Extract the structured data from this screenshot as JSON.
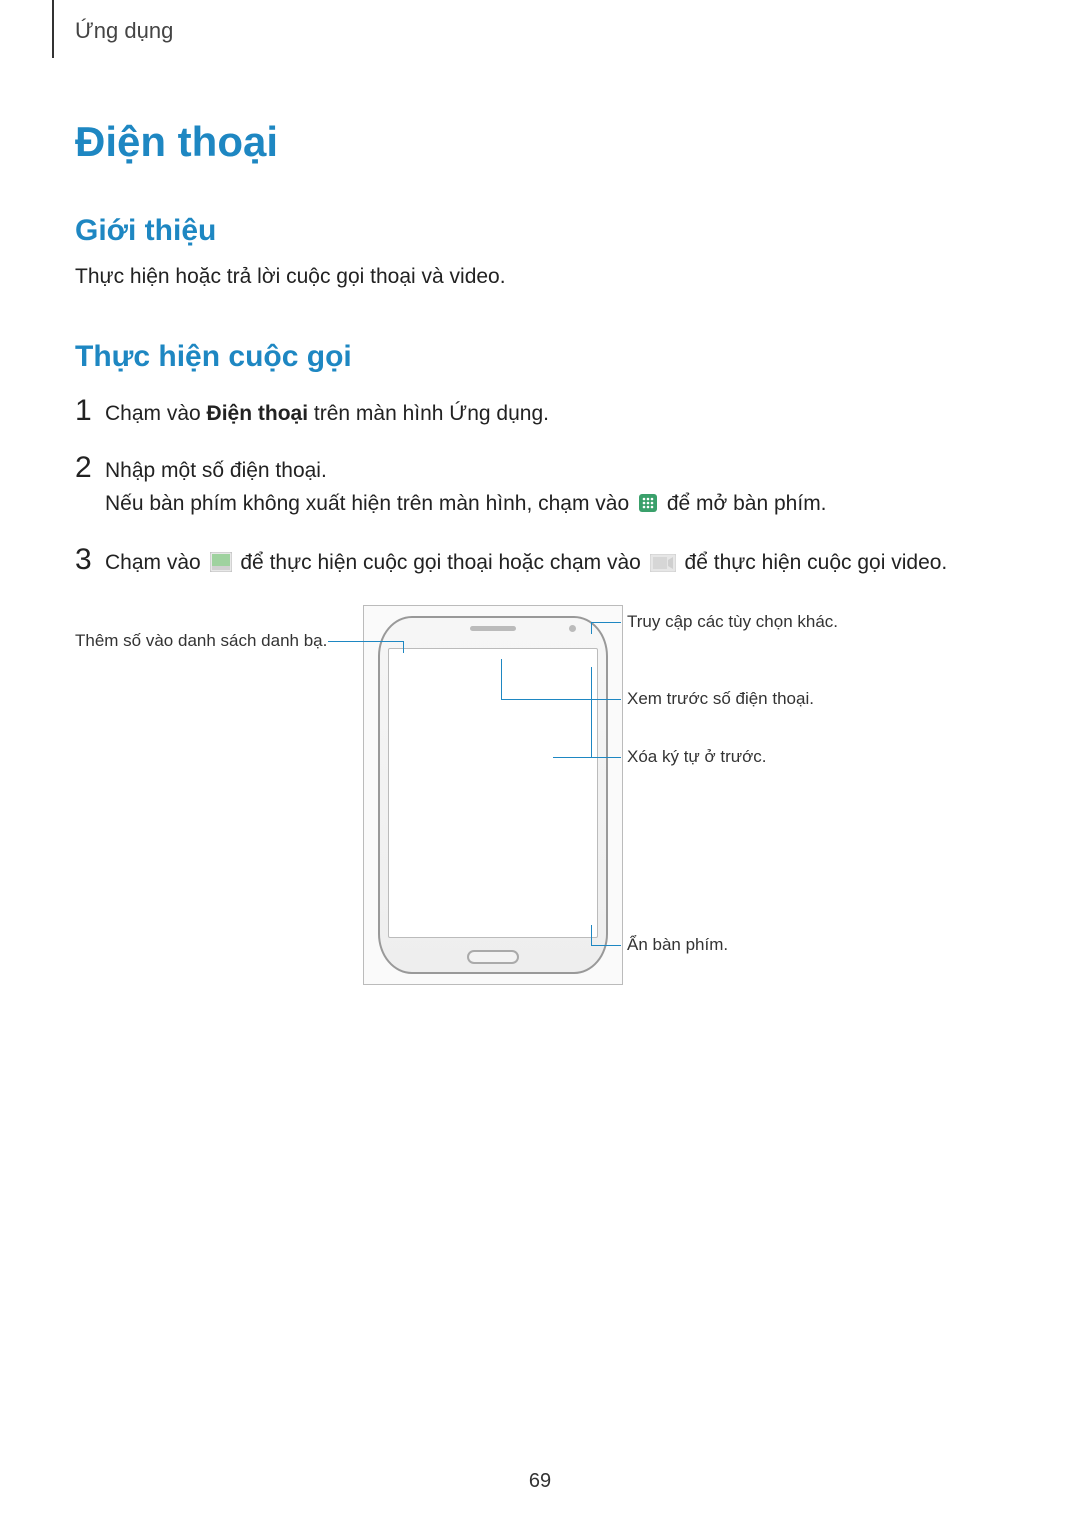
{
  "header": {
    "section": "Ứng dụng"
  },
  "title": "Điện thoại",
  "intro": {
    "heading": "Giới thiệu",
    "text": "Thực hiện hoặc trả lời cuộc gọi thoại và video."
  },
  "make_call": {
    "heading": "Thực hiện cuộc gọi",
    "steps": [
      {
        "num": "1",
        "parts": [
          {
            "t": "Chạm vào "
          },
          {
            "t": "Điện thoại",
            "bold": true
          },
          {
            "t": " trên màn hình Ứng dụng."
          }
        ]
      },
      {
        "num": "2",
        "parts": [
          {
            "t": "Nhập một số điện thoại."
          },
          {
            "br": true
          },
          {
            "t": "Nếu bàn phím không xuất hiện trên màn hình, chạm vào "
          },
          {
            "icon": "keypad-icon"
          },
          {
            "t": " để mở bàn phím."
          }
        ]
      },
      {
        "num": "3",
        "parts": [
          {
            "t": "Chạm vào "
          },
          {
            "icon": "voice-call-icon"
          },
          {
            "t": " để thực hiện cuộc gọi thoại hoặc chạm vào "
          },
          {
            "icon": "video-call-icon"
          },
          {
            "t": " để thực hiện cuộc gọi video."
          }
        ]
      }
    ]
  },
  "callouts": {
    "add_contact": "Thêm số vào danh sách danh bạ.",
    "more_options": "Truy cập các tùy chọn khác.",
    "preview_number": "Xem trước số điện thoại.",
    "delete_char": "Xóa ký tự ở trước.",
    "hide_keypad": "Ẩn bàn phím."
  },
  "page_number": "69",
  "icons": {
    "keypad-icon": "keypad",
    "voice-call-icon": "voice-call",
    "video-call-icon": "video-call"
  }
}
